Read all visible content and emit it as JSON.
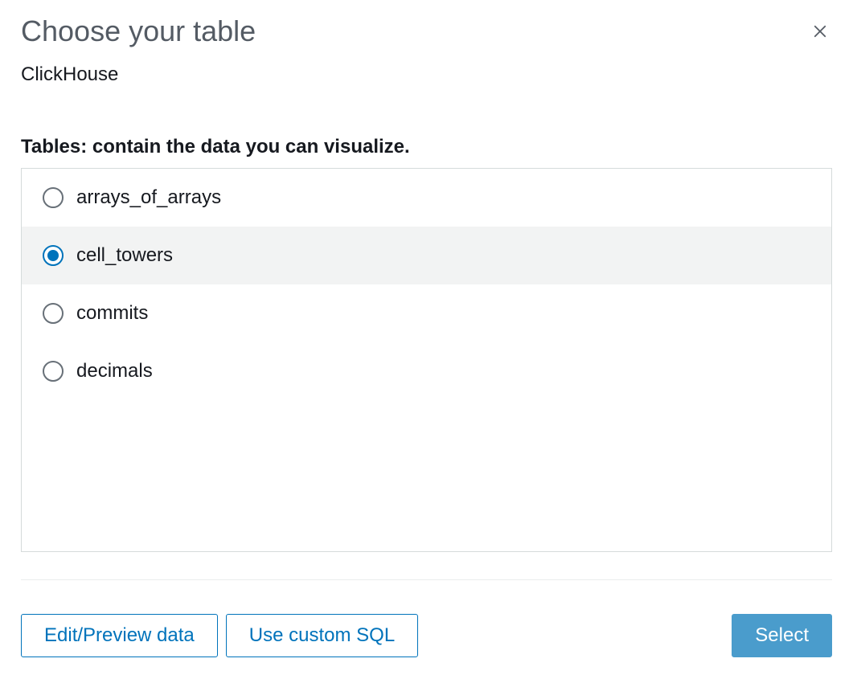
{
  "dialog": {
    "title": "Choose your table",
    "datasource_name": "ClickHouse",
    "description": "Tables: contain the data you can visualize."
  },
  "tables": {
    "selected_index": 1,
    "items": [
      {
        "name": "arrays_of_arrays"
      },
      {
        "name": "cell_towers"
      },
      {
        "name": "commits"
      },
      {
        "name": "decimals"
      }
    ]
  },
  "footer": {
    "edit_preview_label": "Edit/Preview data",
    "custom_sql_label": "Use custom SQL",
    "select_label": "Select"
  }
}
